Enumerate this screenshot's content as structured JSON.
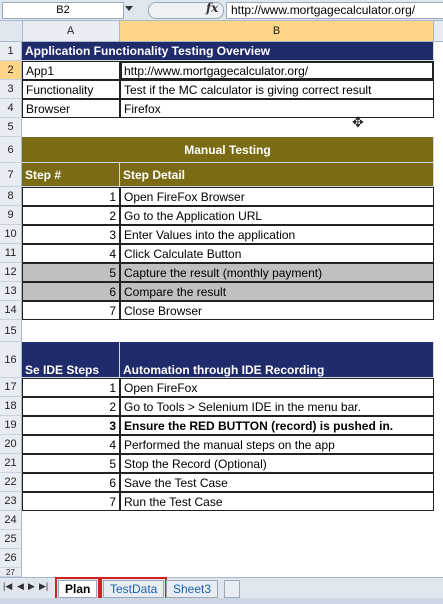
{
  "formula_bar": {
    "name_box": "B2",
    "fx": "fx",
    "formula": "http://www.mortgagecalculator.org/"
  },
  "columns": [
    "A",
    "B"
  ],
  "rows": [
    "1",
    "2",
    "3",
    "4",
    "5",
    "6",
    "7",
    "8",
    "9",
    "10",
    "11",
    "12",
    "13",
    "14",
    "15",
    "16",
    "17",
    "18",
    "19",
    "20",
    "21",
    "22",
    "23",
    "24",
    "25",
    "26",
    "27"
  ],
  "overview": {
    "title": "Application Functionality Testing Overview",
    "rows": [
      {
        "label": "App1",
        "value": "http://www.mortgagecalculator.org/"
      },
      {
        "label": "Functionality",
        "value": "Test if the MC calculator is giving correct result"
      },
      {
        "label": "Browser",
        "value": "Firefox"
      }
    ]
  },
  "manual": {
    "title": "Manual Testing",
    "col1": "Step #",
    "col2": "Step Detail",
    "steps": [
      {
        "n": "1",
        "text": "Open FireFox Browser"
      },
      {
        "n": "2",
        "text": "Go to the Application URL"
      },
      {
        "n": "3",
        "text": "Enter Values into the application"
      },
      {
        "n": "4",
        "text": "Click Calculate Button"
      },
      {
        "n": "5",
        "text": "Capture the result (monthly payment)"
      },
      {
        "n": "6",
        "text": "Compare the result"
      },
      {
        "n": "7",
        "text": "Close Browser"
      }
    ]
  },
  "ide": {
    "col1": "Se IDE Steps",
    "col2": "Automation through IDE Recording",
    "steps": [
      {
        "n": "1",
        "text": "Open FireFox"
      },
      {
        "n": "2",
        "text": "Go to Tools > Selenium IDE in the menu bar."
      },
      {
        "n": "3",
        "text": "Ensure the RED BUTTON (record) is pushed in."
      },
      {
        "n": "4",
        "text": "Performed the manual steps on the app"
      },
      {
        "n": "5",
        "text": "Stop the Record (Optional)"
      },
      {
        "n": "6",
        "text": "Save the Test Case"
      },
      {
        "n": "7",
        "text": "Run the Test Case"
      }
    ]
  },
  "tabs": [
    "Plan",
    "TestData",
    "Sheet3"
  ],
  "colors": {
    "navy": "#1f2b6b",
    "olive": "#7b6b14",
    "highlight_gray": "#c0c0c0",
    "annotation_red": "#d02020"
  }
}
